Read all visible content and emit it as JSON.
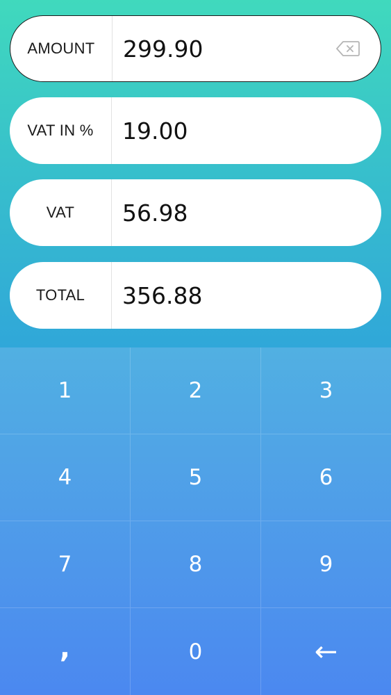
{
  "fields": [
    {
      "label": "AMOUNT",
      "value": "299.90",
      "active": true
    },
    {
      "label": "VAT IN %",
      "value": "19.00",
      "active": false
    },
    {
      "label": "VAT",
      "value": "56.98",
      "active": false
    },
    {
      "label": "TOTAL",
      "value": "356.88",
      "active": false
    }
  ],
  "keypad": {
    "keys": [
      "1",
      "2",
      "3",
      "4",
      "5",
      "6",
      "7",
      "8",
      "9",
      ",",
      "0",
      "←"
    ]
  },
  "colors": {
    "top_gradient_start": "#40d9bd",
    "top_gradient_end": "#30a7d9",
    "keypad_gradient_start": "#51b0e2",
    "keypad_gradient_end": "#4b88f0"
  }
}
